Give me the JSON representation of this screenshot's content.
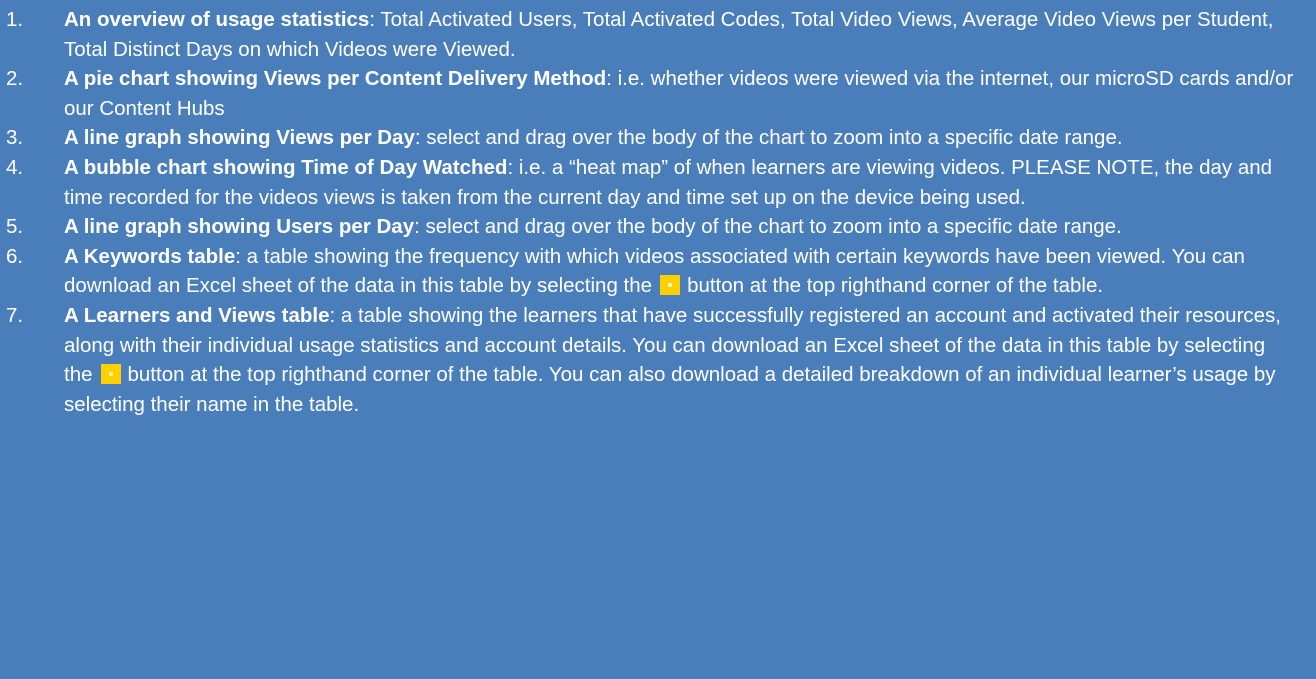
{
  "items": [
    {
      "number": "1.",
      "title": "An overview of usage statistics",
      "text": ": Total Activated Users, Total Activated Codes, Total Video Views, Average Video Views per Student, Total Distinct Days on which Videos were Viewed."
    },
    {
      "number": "2.",
      "title": "A pie chart showing Views per Content Delivery Method",
      "text": ": i.e. whether videos were viewed via the internet, our microSD cards and/or our Content Hubs"
    },
    {
      "number": "3.",
      "title": "A line graph showing Views per Day",
      "text": ": select and drag over the body of the chart to zoom into a specific date range."
    },
    {
      "number": "4.",
      "title": "A bubble chart showing Time of Day Watched",
      "text": ": i.e. a “heat map” of when learners are viewing videos. PLEASE NOTE, the day and time recorded for the videos views is taken from the current day and time set up on the device being used."
    },
    {
      "number": "5.",
      "title": "A line graph showing Users per Day",
      "text": ": select and drag over the body of the chart to zoom into a specific date range."
    },
    {
      "number": "6.",
      "title": "A Keywords table",
      "text_before": ": a table showing the frequency with which videos associated with certain keywords have been viewed. You can download an Excel sheet of the data in this table by selecting the",
      "text_after": "button at the top righthand corner of the table."
    },
    {
      "number": "7.",
      "title": "A Learners and Views table",
      "text_before": ": a table showing the learners that have successfully registered an account and activated their resources, along with their individual usage statistics and account details. You can download an Excel sheet of the data in this table by selecting the",
      "text_after": "button at the top righthand corner of the table. You can also download a detailed breakdown of an individual learner’s usage by selecting their name in the table."
    }
  ],
  "icons": {
    "download_button": "excel-download-icon"
  },
  "colors": {
    "background": "#4a7ebb",
    "text": "#ffffff",
    "download_button": "#ffcf00"
  }
}
